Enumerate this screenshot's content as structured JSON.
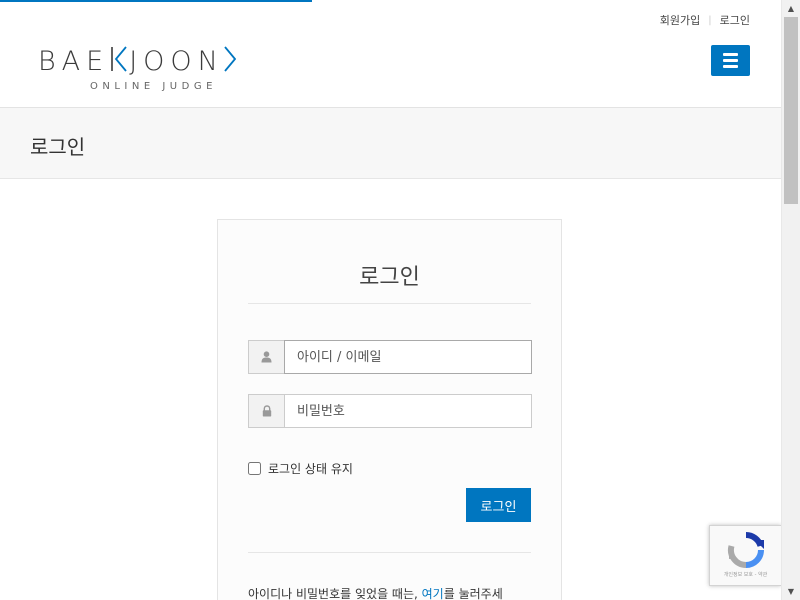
{
  "header": {
    "signup_link": "회원가입",
    "login_link": "로그인",
    "logo": {
      "part1": "BAE",
      "part2": "JOON",
      "subtitle": "ONLINE JUDGE"
    },
    "menu_icon": "hamburger-icon"
  },
  "page": {
    "title": "로그인"
  },
  "login_form": {
    "title": "로그인",
    "username_placeholder": "아이디 / 이메일",
    "password_placeholder": "비밀번호",
    "remember_label": "로그인 상태 유지",
    "remember_checked": false,
    "submit_label": "로그인",
    "forgot_text_before": "아이디나 비밀번호를 잊었을 때는, ",
    "forgot_link": "여기",
    "forgot_text_after": "를 눌러주세"
  },
  "recaptcha": {
    "terms": "개인정보 보호 - 약관"
  },
  "page_load_progress": 0.39,
  "colors": {
    "accent": "#0076c0",
    "title_band": "#f7f7f7"
  }
}
